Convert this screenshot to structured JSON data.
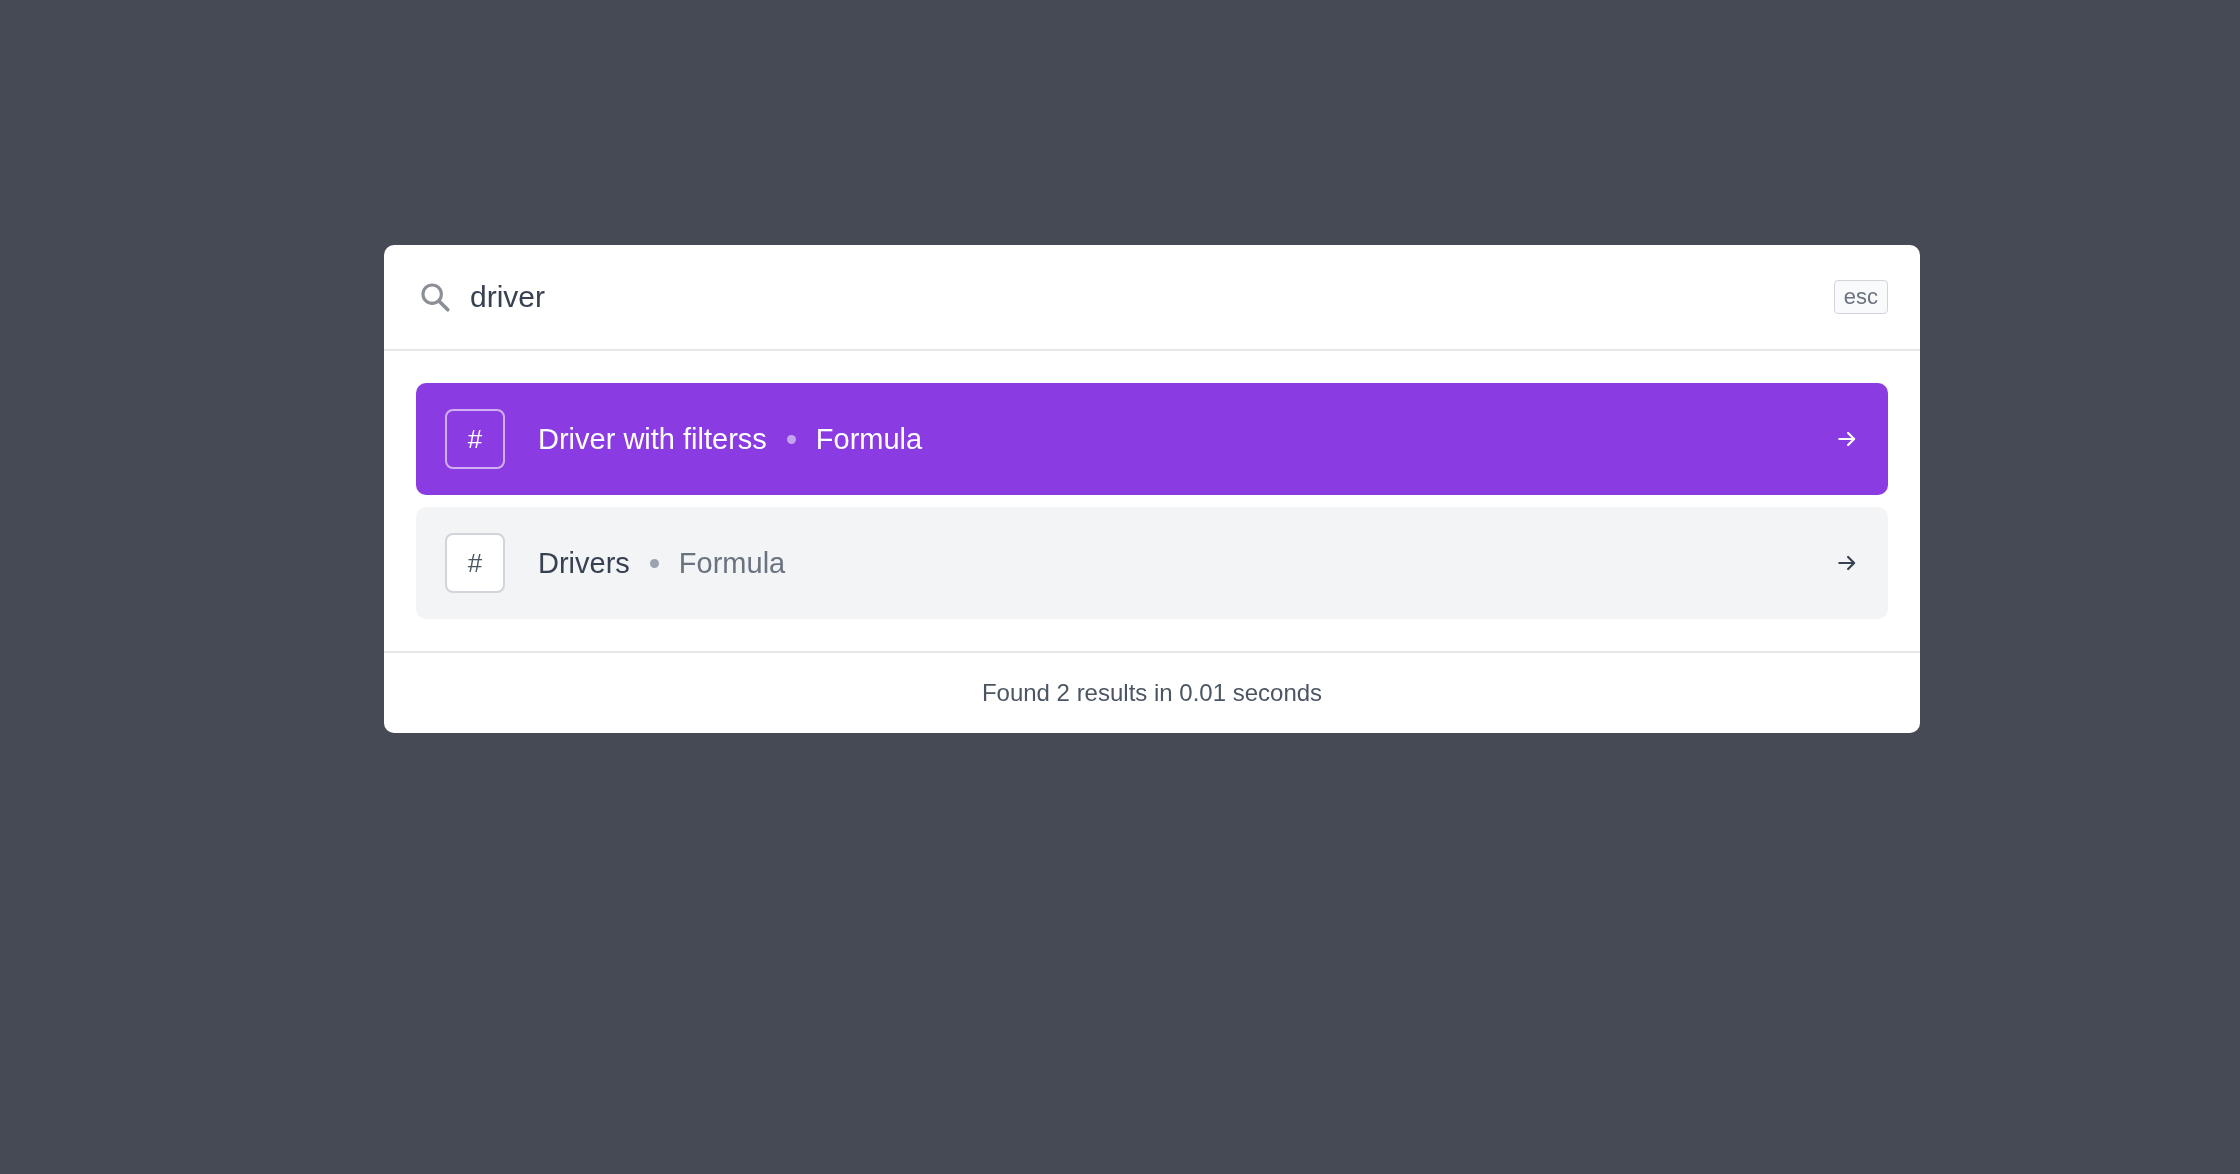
{
  "search": {
    "value": "driver",
    "shortcut": "esc"
  },
  "results": [
    {
      "icon": "#",
      "title": "Driver with filterss",
      "type": "Formula",
      "selected": true
    },
    {
      "icon": "#",
      "title": "Drivers",
      "type": "Formula",
      "selected": false
    }
  ],
  "footer": "Found 2 results in 0.01 seconds"
}
